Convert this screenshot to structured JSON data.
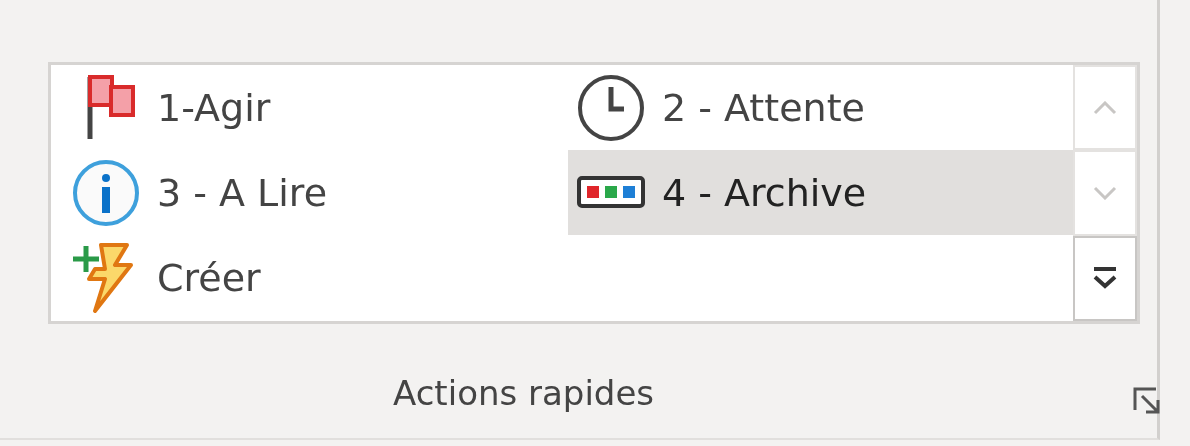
{
  "gallery": {
    "items": [
      {
        "label": "1-Agir",
        "selected": false
      },
      {
        "label": "2 - Attente",
        "selected": false
      },
      {
        "label": "3 - A Lire",
        "selected": false
      },
      {
        "label": "4 - Archive",
        "selected": true
      },
      {
        "label": "Créer",
        "selected": false
      }
    ],
    "scroll_up": {
      "disabled": true
    },
    "scroll_down": {
      "disabled": true
    }
  },
  "group": {
    "label": "Actions rapides"
  }
}
